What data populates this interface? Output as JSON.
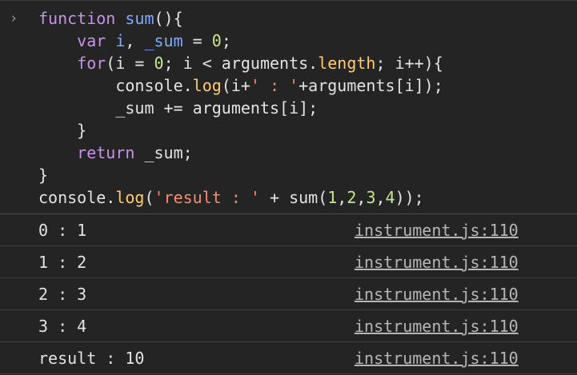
{
  "prompt_symbol": "›",
  "code_lines": [
    [
      {
        "t": "function ",
        "c": "kw"
      },
      {
        "t": "sum",
        "c": "fn"
      },
      {
        "t": "(){",
        "c": "op"
      }
    ],
    [
      {
        "t": "    var ",
        "c": "kw"
      },
      {
        "t": "i",
        "c": "fn"
      },
      {
        "t": ", ",
        "c": "op"
      },
      {
        "t": "_sum",
        "c": "fn"
      },
      {
        "t": " = ",
        "c": "op"
      },
      {
        "t": "0",
        "c": "num"
      },
      {
        "t": ";",
        "c": "op"
      }
    ],
    [
      {
        "t": "    for",
        "c": "kw"
      },
      {
        "t": "(i = ",
        "c": "op"
      },
      {
        "t": "0",
        "c": "num"
      },
      {
        "t": "; i < arguments.",
        "c": "op"
      },
      {
        "t": "length",
        "c": "prop"
      },
      {
        "t": "; i++){",
        "c": "op"
      }
    ],
    [
      {
        "t": "        console.",
        "c": "op"
      },
      {
        "t": "log",
        "c": "prop"
      },
      {
        "t": "(i+",
        "c": "op"
      },
      {
        "t": "' : '",
        "c": "str"
      },
      {
        "t": "+arguments[i]);",
        "c": "op"
      }
    ],
    [
      {
        "t": "        _sum += arguments[i];",
        "c": "op"
      }
    ],
    [
      {
        "t": "    }",
        "c": "op"
      }
    ],
    [
      {
        "t": "    return ",
        "c": "kw"
      },
      {
        "t": "_sum;",
        "c": "op"
      }
    ],
    [
      {
        "t": "}",
        "c": "op"
      }
    ],
    [
      {
        "t": "console.",
        "c": "op"
      },
      {
        "t": "log",
        "c": "prop"
      },
      {
        "t": "(",
        "c": "op"
      },
      {
        "t": "'result : '",
        "c": "str"
      },
      {
        "t": " + sum(",
        "c": "op"
      },
      {
        "t": "1",
        "c": "num"
      },
      {
        "t": ",",
        "c": "op"
      },
      {
        "t": "2",
        "c": "num"
      },
      {
        "t": ",",
        "c": "op"
      },
      {
        "t": "3",
        "c": "num"
      },
      {
        "t": ",",
        "c": "op"
      },
      {
        "t": "4",
        "c": "num"
      },
      {
        "t": "));",
        "c": "op"
      }
    ]
  ],
  "logs": [
    {
      "message": "0 : 1",
      "source": "instrument.js:110"
    },
    {
      "message": "1 : 2",
      "source": "instrument.js:110"
    },
    {
      "message": "2 : 3",
      "source": "instrument.js:110"
    },
    {
      "message": "3 : 4",
      "source": "instrument.js:110"
    },
    {
      "message": "result : 10",
      "source": "instrument.js:110"
    }
  ]
}
